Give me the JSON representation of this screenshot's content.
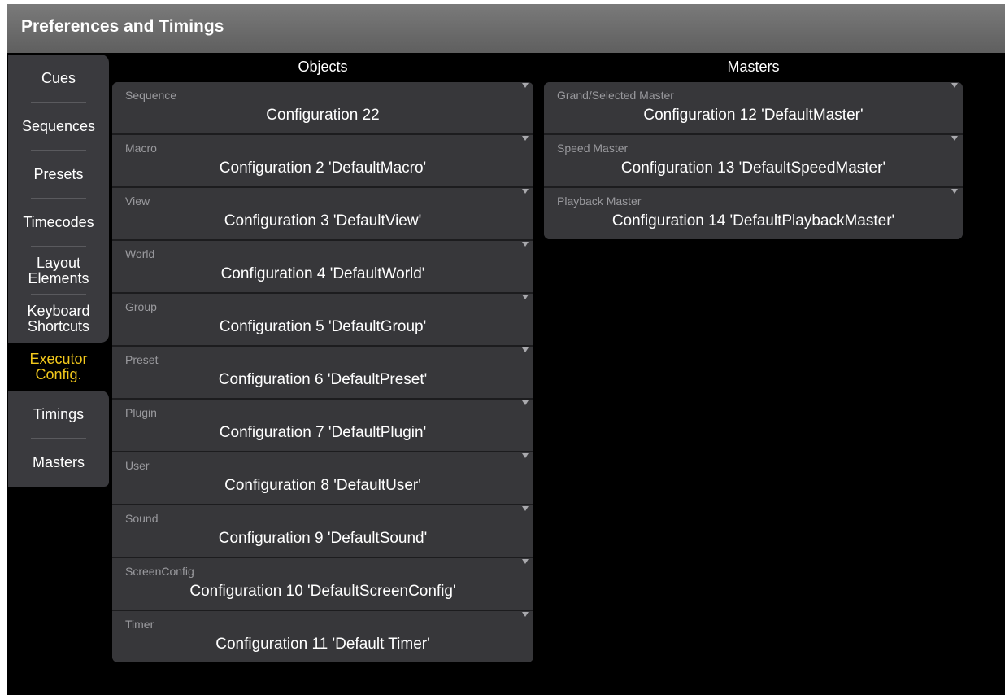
{
  "window": {
    "title": "Preferences and Timings"
  },
  "tabs": [
    {
      "label": "Cues"
    },
    {
      "label": "Sequences"
    },
    {
      "label": "Presets"
    },
    {
      "label": "Timecodes"
    },
    {
      "label": "Layout\nElements"
    },
    {
      "label": "Keyboard\nShortcuts"
    },
    {
      "label": "Executor\nConfig.",
      "active": true
    },
    {
      "label": "Timings"
    },
    {
      "label": "Masters"
    }
  ],
  "objects": {
    "header": "Objects",
    "items": [
      {
        "label": "Sequence",
        "value": "Configuration 22"
      },
      {
        "label": "Macro",
        "value": "Configuration 2 'DefaultMacro'"
      },
      {
        "label": "View",
        "value": "Configuration 3 'DefaultView'"
      },
      {
        "label": "World",
        "value": "Configuration 4 'DefaultWorld'"
      },
      {
        "label": "Group",
        "value": "Configuration 5 'DefaultGroup'"
      },
      {
        "label": "Preset",
        "value": "Configuration 6 'DefaultPreset'"
      },
      {
        "label": "Plugin",
        "value": "Configuration 7 'DefaultPlugin'"
      },
      {
        "label": "User",
        "value": "Configuration 8 'DefaultUser'"
      },
      {
        "label": "Sound",
        "value": "Configuration 9 'DefaultSound'"
      },
      {
        "label": "ScreenConfig",
        "value": "Configuration 10 'DefaultScreenConfig'"
      },
      {
        "label": "Timer",
        "value": "Configuration 11 'Default Timer'"
      }
    ]
  },
  "masters": {
    "header": "Masters",
    "items": [
      {
        "label": "Grand/Selected Master",
        "value": "Configuration 12 'DefaultMaster'"
      },
      {
        "label": "Speed Master",
        "value": "Configuration 13 'DefaultSpeedMaster'"
      },
      {
        "label": "Playback Master",
        "value": "Configuration 14 'DefaultPlaybackMaster'"
      }
    ]
  },
  "colors": {
    "active_tab_text": "#f2c81c",
    "panel": "#37373a",
    "background": "#000000"
  },
  "icons": {
    "dropdown": "dropdown-arrow-icon"
  }
}
